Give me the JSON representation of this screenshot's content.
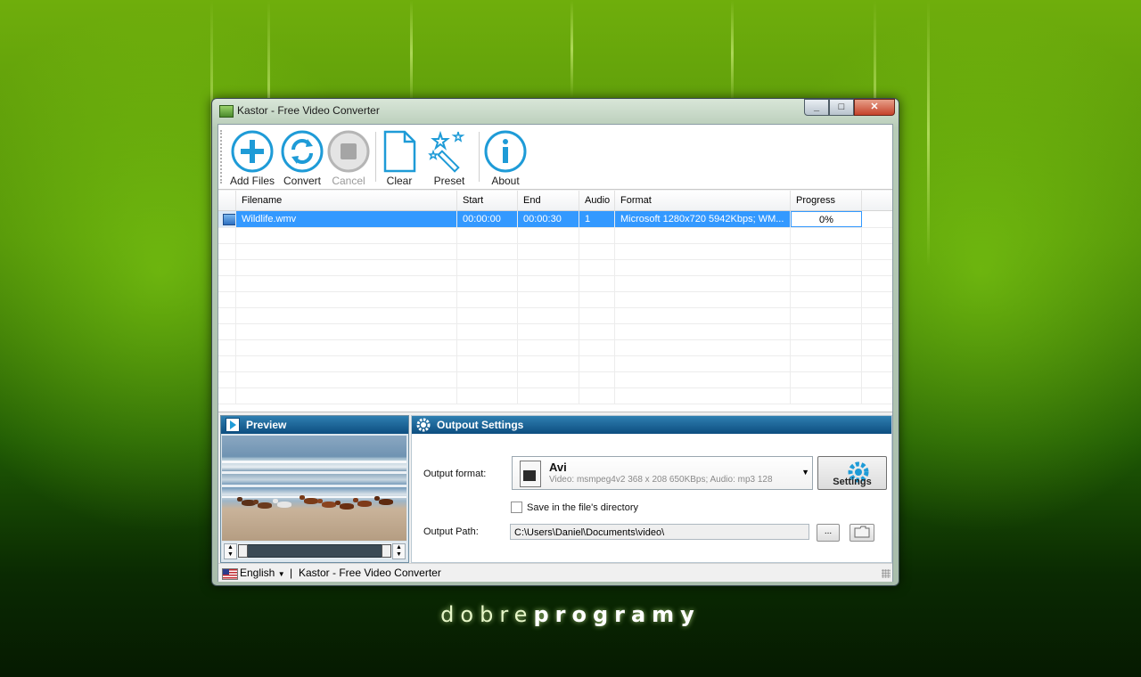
{
  "window": {
    "title": "Kastor - Free Video Converter"
  },
  "toolbar": {
    "add_files": "Add Files",
    "convert": "Convert",
    "cancel": "Cancel",
    "clear": "Clear",
    "preset": "Preset",
    "about": "About"
  },
  "grid": {
    "columns": [
      "Filename",
      "Start",
      "End",
      "Audio",
      "Format",
      "Progress"
    ],
    "rows": [
      {
        "filename": "Wildlife.wmv",
        "start": "00:00:00",
        "end": "00:00:30",
        "audio": "1",
        "format": "Microsoft 1280x720 5942Kbps; WM...",
        "progress": "0%"
      }
    ]
  },
  "preview": {
    "title": "Preview"
  },
  "settings": {
    "title": "Outpout Settings",
    "output_format_label": "Output format:",
    "format_name": "Avi",
    "format_desc": "Video: msmpeg4v2 368 x 208 650KBps; Audio: mp3 128",
    "settings_button": "Settings",
    "save_in_dir_label": "Save in the file's directory",
    "output_path_label": "Output Path:",
    "output_path": "C:\\Users\\Daniel\\Documents\\video\\",
    "browse_button": "...",
    "open_folder_icon": "folder-icon"
  },
  "statusbar": {
    "language": "English",
    "separator": "|",
    "app_name": "Kastor - Free Video Converter"
  },
  "brand": {
    "light": "dobre",
    "bold": "programy"
  },
  "colors": {
    "accent": "#1e9bd7",
    "selection": "#3399ff",
    "panel_header": "#0d4e80"
  }
}
